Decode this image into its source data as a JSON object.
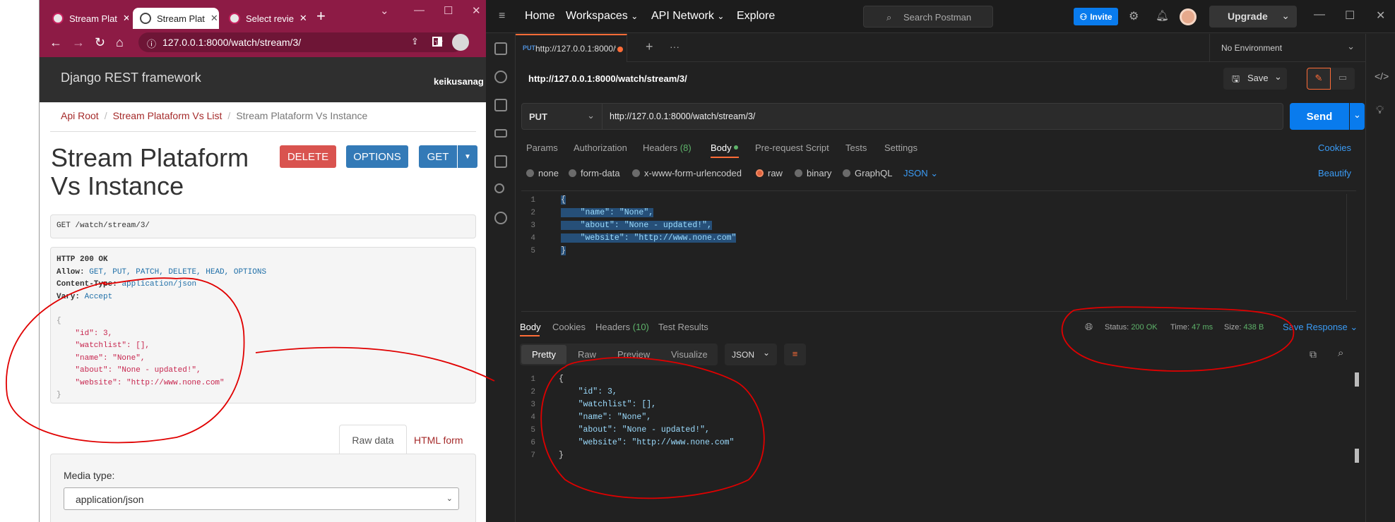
{
  "browser": {
    "tabs": [
      {
        "label": "Stream Plat"
      },
      {
        "label": "Stream Plat"
      },
      {
        "label": "Select revie"
      }
    ],
    "new_tab": "+",
    "url": "127.0.0.1:8000/watch/stream/3/"
  },
  "drf": {
    "brand": "Django REST framework",
    "user": "keikusanag",
    "breadcrumbs": [
      "Api Root",
      "Stream Plataform Vs List",
      "Stream Plataform Vs Instance"
    ],
    "breadcrumb_sep": "/",
    "title_line1": "Stream Plataform",
    "title_line2": "Vs Instance",
    "buttons": {
      "delete": "DELETE",
      "options": "OPTIONS",
      "get": "GET"
    },
    "request_line": "GET /watch/stream/3/",
    "response": {
      "status": "HTTP 200 OK",
      "allow_label": "Allow:",
      "allow_value": "GET, PUT, PATCH, DELETE, HEAD, OPTIONS",
      "ctype_label": "Content-Type:",
      "ctype_value": "application/json",
      "vary_label": "Vary:",
      "vary_value": "Accept",
      "json_lines": [
        "{",
        "    \"id\": 3,",
        "    \"watchlist\": [],",
        "    \"name\": \"None\",",
        "    \"about\": \"None - updated!\",",
        "    \"website\": \"http://www.none.com\"",
        "}"
      ]
    },
    "form_tabs": {
      "raw": "Raw data",
      "html": "HTML form"
    },
    "media_type_label": "Media type:",
    "media_type_value": "application/json"
  },
  "postman": {
    "nav": {
      "home": "Home",
      "workspaces": "Workspaces",
      "api_network": "API Network",
      "explore": "Explore"
    },
    "search_placeholder": "Search Postman",
    "invite": "Invite",
    "upgrade": "Upgrade",
    "tab_method": "PUT",
    "tab_url": "http://127.0.0.1:8000/w",
    "environment": "No Environment",
    "request_name": "http://127.0.0.1:8000/watch/stream/3/",
    "save": "Save",
    "method": "PUT",
    "url": "http://127.0.0.1:8000/watch/stream/3/",
    "send": "Send",
    "req_tabs": {
      "params": "Params",
      "authorization": "Authorization",
      "headers": "Headers",
      "headers_count": "(8)",
      "body": "Body",
      "prerequest": "Pre-request Script",
      "tests": "Tests",
      "settings": "Settings"
    },
    "cookies": "Cookies",
    "body_types": {
      "none": "none",
      "form_data": "form-data",
      "urlencoded": "x-www-form-urlencoded",
      "raw": "raw",
      "binary": "binary",
      "graphql": "GraphQL",
      "json": "JSON"
    },
    "beautify": "Beautify",
    "req_body_lines": [
      "{",
      "    \"name\": \"None\",",
      "    \"about\": \"None - updated!\",",
      "    \"website\": \"http://www.none.com\"",
      "}"
    ],
    "line_numbers_req": [
      "1",
      "2",
      "3",
      "4",
      "5"
    ],
    "resp_tabs": {
      "body": "Body",
      "cookies": "Cookies",
      "headers": "Headers",
      "headers_count": "(10)",
      "tests": "Test Results"
    },
    "status_label": "Status:",
    "status_value": "200 OK",
    "time_label": "Time:",
    "time_value": "47 ms",
    "size_label": "Size:",
    "size_value": "438 B",
    "save_response": "Save Response",
    "view_tabs": {
      "pretty": "Pretty",
      "raw": "Raw",
      "preview": "Preview",
      "visualize": "Visualize"
    },
    "format": "JSON",
    "resp_body_lines": [
      "{",
      "    \"id\": 3,",
      "    \"watchlist\": [],",
      "    \"name\": \"None\",",
      "    \"about\": \"None - updated!\",",
      "    \"website\": \"http://www.none.com\"",
      "}"
    ],
    "line_numbers_resp": [
      "1",
      "2",
      "3",
      "4",
      "5",
      "6",
      "7"
    ]
  },
  "colors": {
    "chrome_frame": "#8d1b45",
    "drf_header": "#2f2f2f",
    "drf_link": "#a52a2a",
    "pm_bg": "#212121",
    "pm_accent": "#ff6c37",
    "send_blue": "#097bed",
    "annotation": "#e00000"
  }
}
